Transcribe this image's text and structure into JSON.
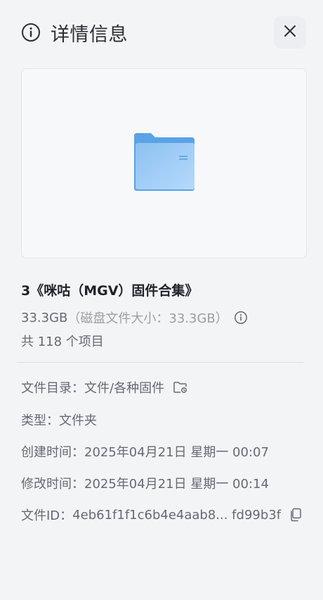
{
  "header": {
    "title": "详情信息",
    "info_icon": "info-circle-icon",
    "close_icon": "close-icon"
  },
  "preview": {
    "icon": "folder-icon",
    "folder_color": "#7fb6ee"
  },
  "item": {
    "name": "3《咪咕（MGV）固件合集》",
    "size": "33.3GB",
    "disk_size": "（磁盘文件大小：33.3GB）",
    "count": "共 118 个项目"
  },
  "meta": {
    "directory_label": "文件目录：",
    "directory_value": "文件/各种固件",
    "type_label": "类型：",
    "type_value": "文件夹",
    "created_label": "创建时间：",
    "created_value": "2025年04月21日 星期一 00:07",
    "modified_label": "修改时间：",
    "modified_value": "2025年04月21日 星期一 00:14",
    "id_label": "文件ID：",
    "id_value": "4eb61f1f1c6b4e4aab8... fd99b3f"
  }
}
